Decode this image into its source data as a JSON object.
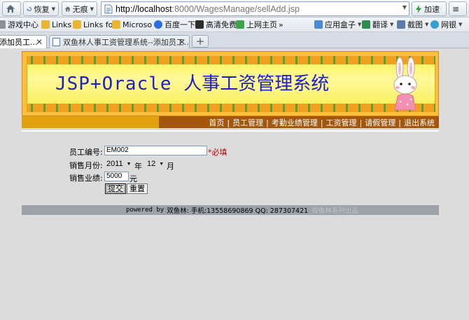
{
  "browser": {
    "back_label": "",
    "restore_label": "恢复",
    "incognito_label": "无痕",
    "url_host": "http://localhost",
    "url_rest": ":8000/WagesManage/sellAdd.jsp",
    "speedup_label": "加速",
    "bookmarks": [
      "游戏中心",
      "Links",
      "Links fo",
      "Microso",
      "百度一下",
      "高清免费",
      "上网主页"
    ],
    "bookmarks_more": "»",
    "right_tools": [
      "应用盒子",
      "翻译",
      "截图",
      "网银"
    ],
    "tabs": [
      {
        "title": "添加员工...",
        "active": true
      },
      {
        "title": "双鱼林人事工资管理系统--添加员工...",
        "active": false
      }
    ],
    "new_tab": "+"
  },
  "banner": {
    "title_latin": "JSP+Oracle ",
    "title_cn": "人事工资管理系统"
  },
  "nav": {
    "items": [
      "首页",
      "员工管理",
      "考勤业绩管理",
      "工资管理",
      "请假管理",
      "退出系统"
    ]
  },
  "form": {
    "employee_no_label": "员工编号:",
    "employee_no_value": "EM002",
    "required_text": "*必填",
    "month_label": "销售月份:",
    "year_value": "2011",
    "year_unit": "年",
    "month_value": "12",
    "month_unit": "月",
    "sales_label": "销售业绩:",
    "sales_value": "5000",
    "sales_unit": "元",
    "submit_label": "提交",
    "reset_label": "重置"
  },
  "footer": {
    "powered": "powered by",
    "text": "双鱼林: 手机:13558690869 QQ: 287307421",
    "faint": "双鱼林系列出品"
  }
}
